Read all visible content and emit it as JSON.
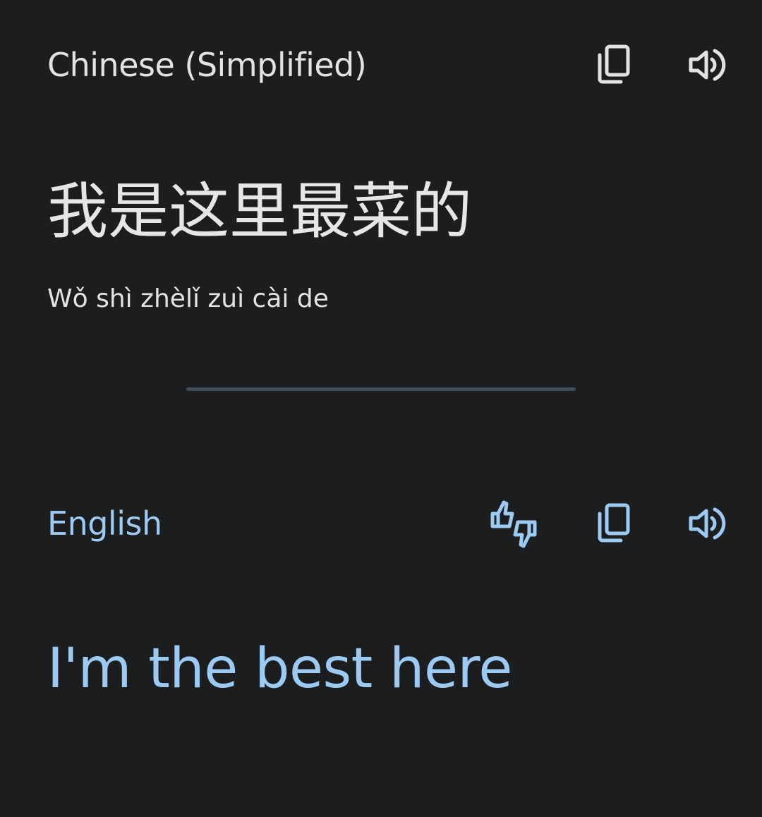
{
  "source": {
    "language": "Chinese (Simplified)",
    "text": "我是这里最菜的",
    "romanization": "Wǒ shì zhèlǐ zuì cài de",
    "actions": [
      "copy-icon",
      "speaker-icon"
    ]
  },
  "target": {
    "language": "English",
    "text": "I'm the best here",
    "actions": [
      "feedback-icon",
      "copy-icon",
      "speaker-icon"
    ]
  },
  "colors": {
    "background": "#1c1d1f",
    "source_text": "#e3e3e3",
    "accent": "#9ccaf3",
    "divider": "#3e4c57"
  }
}
